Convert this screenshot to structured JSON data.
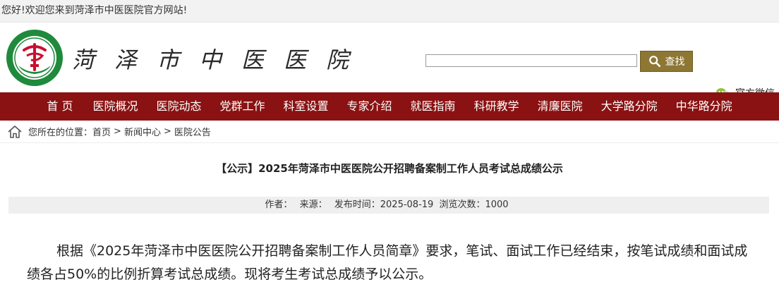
{
  "topbar": {
    "welcome": "您好!欢迎您来到菏泽市中医医院官方网站!"
  },
  "header": {
    "site_name": "菏泽市中医医院",
    "search": {
      "placeholder": "",
      "value": "",
      "button_label": "查找"
    },
    "wechat_label": "官方微信"
  },
  "nav": {
    "items": [
      "首 页",
      "医院概况",
      "医院动态",
      "党群工作",
      "科室设置",
      "专家介绍",
      "就医指南",
      "科研教学",
      "清廉医院",
      "大学路分院",
      "中华路分院"
    ]
  },
  "breadcrumb": {
    "prefix": "您所在的位置：",
    "links": [
      "首页",
      "新闻中心",
      "医院公告"
    ],
    "separator": ">"
  },
  "article": {
    "title": "【公示】2025年菏泽市中医医院公开招聘备案制工作人员考试总成绩公示",
    "meta": {
      "author_label": "作者：",
      "source_label": "来源：",
      "date_label": "发布时间：",
      "date": "2025-08-19",
      "views_label": "浏览次数：",
      "views": "1000"
    },
    "body": "根据《2025年菏泽市中医医院公开招聘备案制工作人员简章》要求，笔试、面试工作已经结束，按笔试成绩和面试成绩各占50%的比例折算考试总成绩。现将考生考试总成绩予以公示。"
  },
  "colors": {
    "nav_bg": "#8a1212",
    "search_btn": "#8d7733",
    "meta_bg": "#efefef",
    "logo_green": "#1f8a3c",
    "logo_red": "#c8102e"
  },
  "icons": {
    "logo": "hospital-logo",
    "search": "search-icon",
    "wechat": "wechat-icon",
    "home": "home-icon"
  }
}
